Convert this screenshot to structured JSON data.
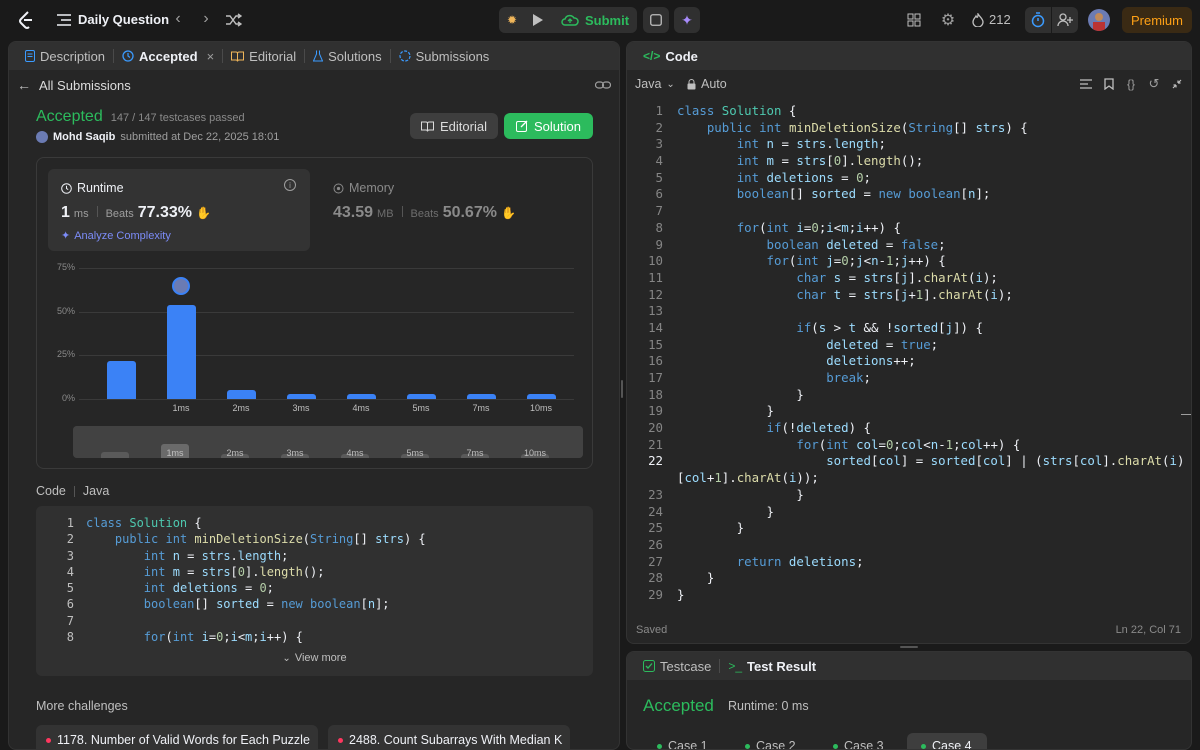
{
  "topbar": {
    "title": "Daily Question",
    "submit": "Submit",
    "streak": "212",
    "premium": "Premium"
  },
  "left": {
    "tabs": [
      "Description",
      "Accepted",
      "Editorial",
      "Solutions",
      "Submissions"
    ],
    "back": "All Submissions",
    "status": "Accepted",
    "passed": "147 / 147 testcases passed",
    "user": "Mohd Saqib",
    "submitted": "submitted at Dec 22, 2025 18:01",
    "editorial_btn": "Editorial",
    "solution_btn": "Solution",
    "runtime": {
      "label": "Runtime",
      "value": "1",
      "unit": "ms",
      "beats_label": "Beats",
      "beats": "77.33%",
      "analyze": "Analyze Complexity"
    },
    "memory": {
      "label": "Memory",
      "value": "43.59",
      "unit": "MB",
      "beats_label": "Beats",
      "beats": "50.67%"
    },
    "code_header": {
      "label": "Code",
      "lang": "Java"
    },
    "view_more": "View more",
    "more_challenges": "More challenges",
    "challenges": [
      "1178. Number of Valid Words for Each Puzzle",
      "2488. Count Subarrays With Median K"
    ]
  },
  "chart_data": {
    "type": "bar",
    "categories": [
      "",
      "1ms",
      "2ms",
      "3ms",
      "4ms",
      "5ms",
      "7ms",
      "10ms"
    ],
    "values": [
      22,
      54,
      5,
      3,
      3,
      3,
      3,
      3
    ],
    "y_ticks": [
      "75%",
      "50%",
      "25%",
      "0%"
    ],
    "ylim": [
      0,
      75
    ],
    "highlight_index": 1
  },
  "code_preview": [
    "class Solution {",
    "    public int minDeletionSize(String[] strs) {",
    "        int n = strs.length;",
    "        int m = strs[0].length();",
    "        int deletions = 0;",
    "        boolean[] sorted = new boolean[n];",
    "",
    "        for(int i=0;i<m;i++) {"
  ],
  "right": {
    "code_tab": "Code",
    "lang": "Java",
    "auto": "Auto",
    "saved": "Saved",
    "cursor": "Ln 22, Col 71",
    "bottom_tabs": [
      "Testcase",
      "Test Result"
    ],
    "result": "Accepted",
    "runtime": "Runtime: 0 ms",
    "cases": [
      "Case 1",
      "Case 2",
      "Case 3",
      "Case 4"
    ]
  },
  "code": [
    "class Solution {",
    "    public int minDeletionSize(String[] strs) {",
    "        int n = strs.length;",
    "        int m = strs[0].length();",
    "        int deletions = 0;",
    "        boolean[] sorted = new boolean[n];",
    "",
    "        for(int i=0;i<m;i++) {",
    "            boolean deleted = false;",
    "            for(int j=0;j<n-1;j++) {",
    "                char s = strs[j].charAt(i);",
    "                char t = strs[j+1].charAt(i);",
    "",
    "                if(s > t && !sorted[j]) {",
    "                    deleted = true;",
    "                    deletions++;",
    "                    break;",
    "                }",
    "            }",
    "            if(!deleted) {",
    "                for(int col=0;col<n-1;col++) {",
    "                    sorted[col] = sorted[col] | (strs[col].charAt(i) < strs",
    "[col+1].charAt(i));",
    "                }",
    "            }",
    "        }",
    "",
    "        return deletions;",
    "    }",
    "}"
  ],
  "line_numbers": [
    "1",
    "2",
    "3",
    "4",
    "5",
    "6",
    "7",
    "8",
    "9",
    "10",
    "11",
    "12",
    "13",
    "14",
    "15",
    "16",
    "17",
    "18",
    "19",
    "20",
    "21",
    "22",
    "",
    "23",
    "24",
    "25",
    "26",
    "27",
    "28",
    "29"
  ],
  "colors": {
    "accent_green": "#2cbb5d",
    "accent_blue": "#3b82f6",
    "bg": "#1a1a1a",
    "panel": "#262626"
  }
}
